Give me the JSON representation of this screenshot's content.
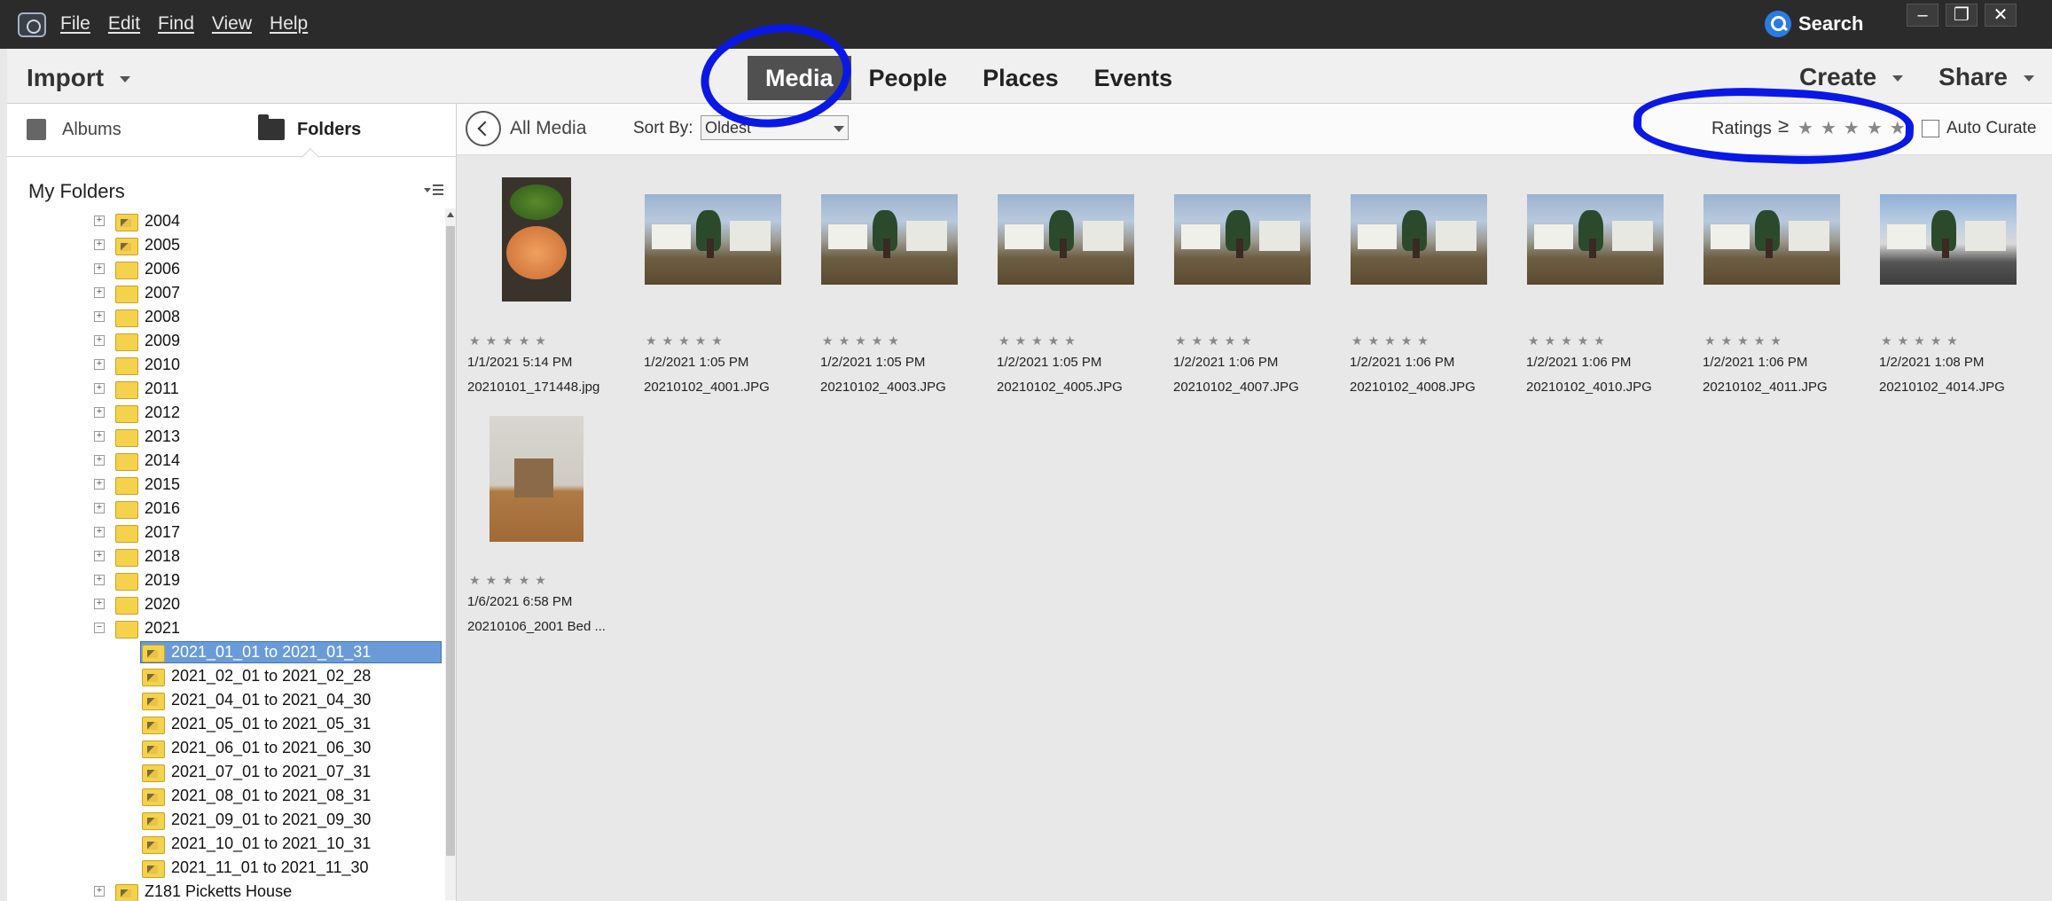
{
  "menu": [
    "File",
    "Edit",
    "Find",
    "View",
    "Help"
  ],
  "top_search_label": "Search",
  "window_buttons": [
    "–",
    "❐",
    "✕"
  ],
  "import_label": "Import",
  "tabs": [
    "Media",
    "People",
    "Places",
    "Events"
  ],
  "right_nav": [
    "Create",
    "Share"
  ],
  "sidebar": {
    "albums_label": "Albums",
    "folders_label": "Folders",
    "my_folders": "My Folders",
    "years": [
      "2004",
      "2005",
      "2006",
      "2007",
      "2008",
      "2009",
      "2010",
      "2011",
      "2012",
      "2013",
      "2014",
      "2015",
      "2016",
      "2017",
      "2018",
      "2019",
      "2020",
      "2021"
    ],
    "subfolders": [
      "2021_01_01 to 2021_01_31",
      "2021_02_01 to 2021_02_28",
      "2021_04_01 to 2021_04_30",
      "2021_05_01 to 2021_05_31",
      "2021_06_01 to 2021_06_30",
      "2021_07_01 to 2021_07_31",
      "2021_08_01 to 2021_08_31",
      "2021_09_01 to 2021_09_30",
      "2021_10_01 to 2021_10_31",
      "2021_11_01 to 2021_11_30"
    ],
    "selected": "2021_01_01 to 2021_01_31",
    "last_folder": "Z181 Picketts House"
  },
  "toolbar": {
    "all_media": "All Media",
    "sort_by": "Sort By:",
    "sort_value": "Oldest",
    "ratings": "Ratings",
    "ratings_op": "≥",
    "auto_curate": "Auto Curate"
  },
  "media": [
    {
      "date": "1/1/2021 5:14 PM",
      "file": "20210101_171448.jpg",
      "thumb": "food"
    },
    {
      "date": "1/2/2021 1:05 PM",
      "file": "20210102_4001.JPG",
      "thumb": "house"
    },
    {
      "date": "1/2/2021 1:05 PM",
      "file": "20210102_4003.JPG",
      "thumb": "house"
    },
    {
      "date": "1/2/2021 1:05 PM",
      "file": "20210102_4005.JPG",
      "thumb": "house"
    },
    {
      "date": "1/2/2021 1:06 PM",
      "file": "20210102_4007.JPG",
      "thumb": "house"
    },
    {
      "date": "1/2/2021 1:06 PM",
      "file": "20210102_4008.JPG",
      "thumb": "house"
    },
    {
      "date": "1/2/2021 1:06 PM",
      "file": "20210102_4010.JPG",
      "thumb": "house"
    },
    {
      "date": "1/2/2021 1:06 PM",
      "file": "20210102_4011.JPG",
      "thumb": "house"
    },
    {
      "date": "1/2/2021 1:08 PM",
      "file": "20210102_4014.JPG",
      "thumb": "house-alt"
    },
    {
      "date": "1/6/2021 6:58 PM",
      "file": "20210106_2001 Bed ...",
      "thumb": "room"
    }
  ],
  "annotation_color": "#0a18e6",
  "selection_color": "#6a9bd8"
}
